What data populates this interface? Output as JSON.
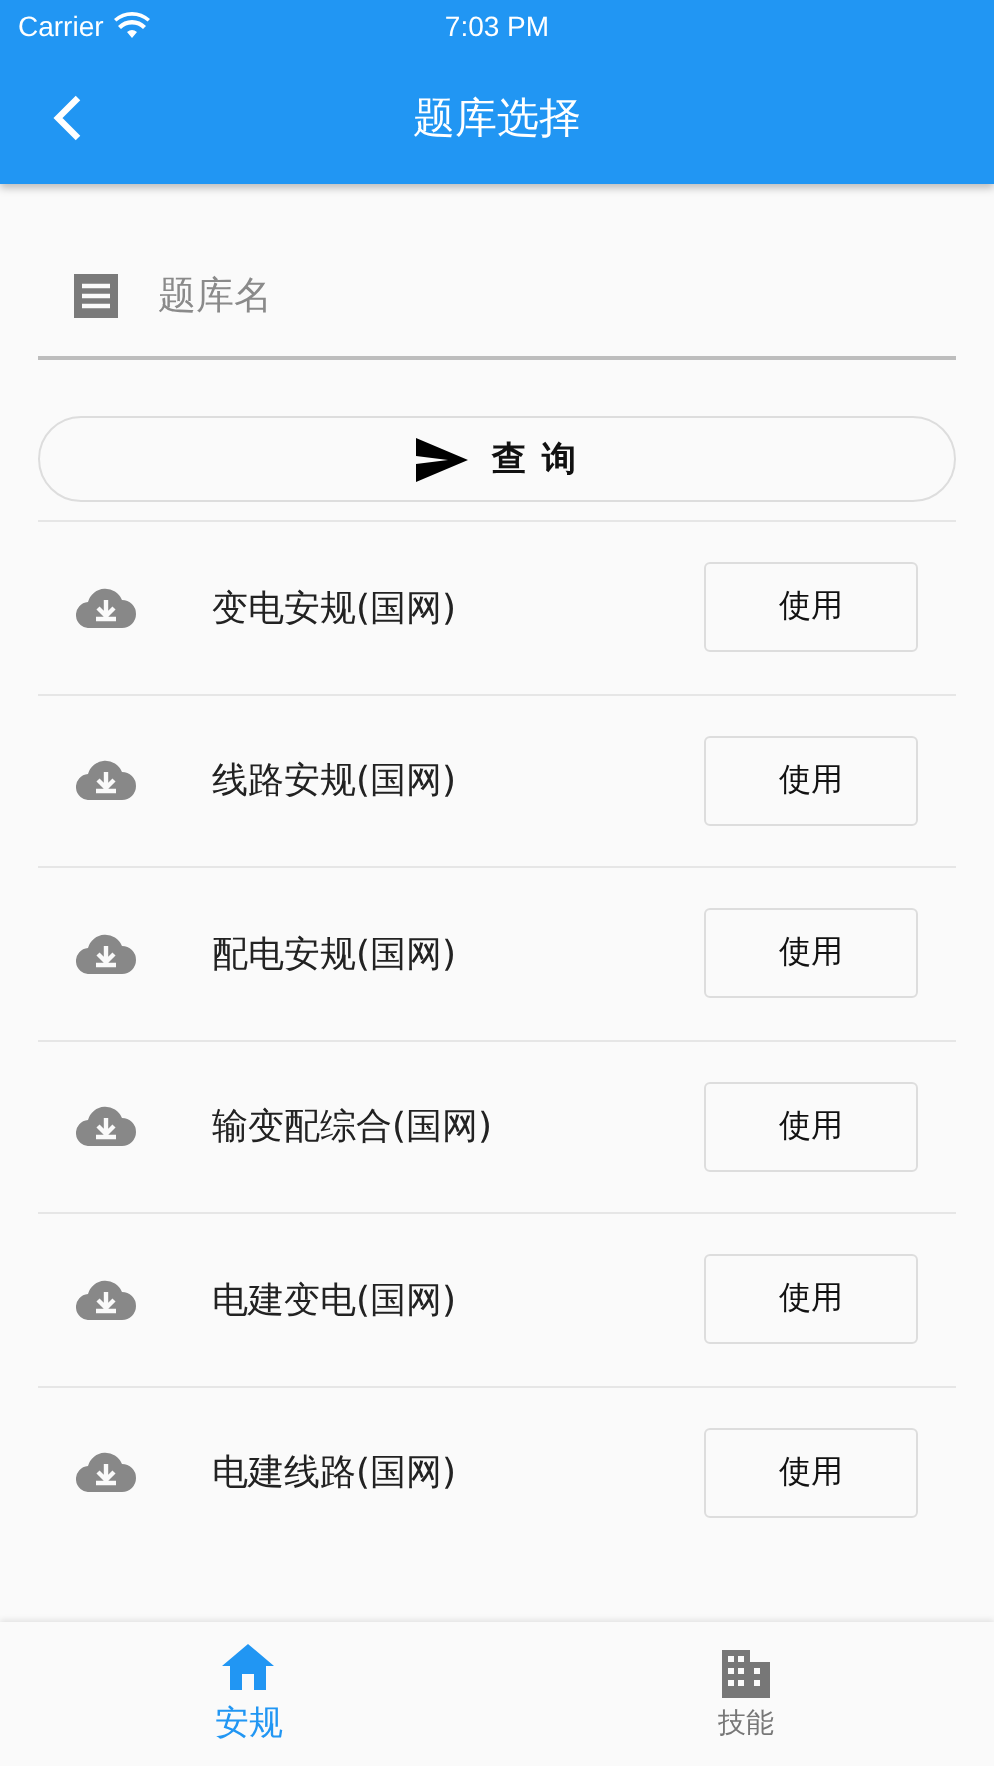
{
  "status_bar": {
    "carrier": "Carrier",
    "time": "7:03 PM"
  },
  "app_bar": {
    "title": "题库选择"
  },
  "search": {
    "placeholder": "题库名",
    "button": "查 询"
  },
  "banks": [
    {
      "name": "变电安规(国网)",
      "action": "使用"
    },
    {
      "name": "线路安规(国网)",
      "action": "使用"
    },
    {
      "name": "配电安规(国网)",
      "action": "使用"
    },
    {
      "name": "输变配综合(国网)",
      "action": "使用"
    },
    {
      "name": "电建变电(国网)",
      "action": "使用"
    },
    {
      "name": "电建线路(国网)",
      "action": "使用"
    }
  ],
  "bottom_nav": [
    {
      "label": "安规",
      "kind": "home",
      "selected": true
    },
    {
      "label": "技能",
      "kind": "building",
      "selected": false
    }
  ]
}
